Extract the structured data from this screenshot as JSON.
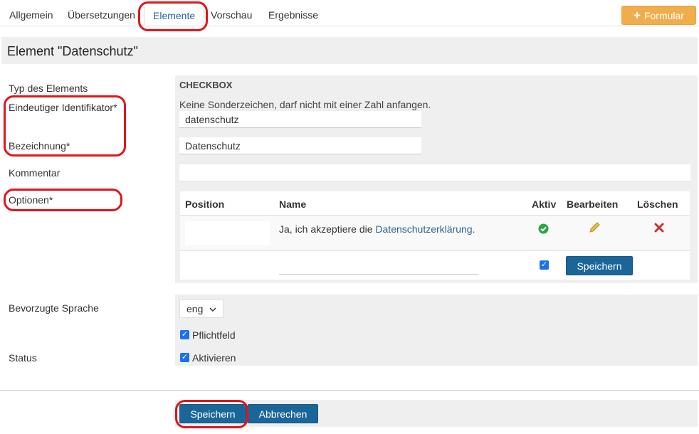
{
  "tabs": [
    {
      "label": "Allgemein"
    },
    {
      "label": "Übersetzungen"
    },
    {
      "label": "Elemente",
      "active": true
    },
    {
      "label": "Vorschau"
    },
    {
      "label": "Ergebnisse"
    }
  ],
  "add_button": {
    "label": "Formular",
    "icon": "plus-icon",
    "color": "#f0ad4e"
  },
  "page_title": "Element \"Datenschutz\"",
  "form": {
    "type_label": "Typ des Elements",
    "type_value": "CHECKBOX",
    "identifier_label": "Eindeutiger Identifikator*",
    "identifier_hint": "Keine Sonderzeichen, darf nicht mit einer Zahl anfangen.",
    "identifier_value": "datenschutz",
    "name_label": "Bezeichnung*",
    "name_value": "Datenschutz",
    "comment_label": "Kommentar",
    "comment_value": "",
    "options_label": "Optionen*",
    "language_label": "Bevorzugte Sprache",
    "language_value": "eng",
    "required_label": "Pflichtfeld",
    "status_label": "Status",
    "activate_label": "Aktivieren"
  },
  "options_table": {
    "headers": {
      "position": "Position",
      "name": "Name",
      "active": "Aktiv",
      "edit": "Bearbeiten",
      "delete": "Löschen"
    },
    "rows": [
      {
        "position": "",
        "name_prefix": "Ja, ich akzeptiere die ",
        "name_link": "Datenschutzerklärung",
        "name_suffix": "."
      }
    ],
    "new_row": {
      "save_label": "Speichern"
    }
  },
  "footer": {
    "save_label": "Speichern",
    "cancel_label": "Abbrechen"
  },
  "colors": {
    "primary": "#1b6698",
    "link": "#2a6496",
    "highlight": "#e0151b",
    "success": "#28a745",
    "danger": "#c9302c"
  }
}
